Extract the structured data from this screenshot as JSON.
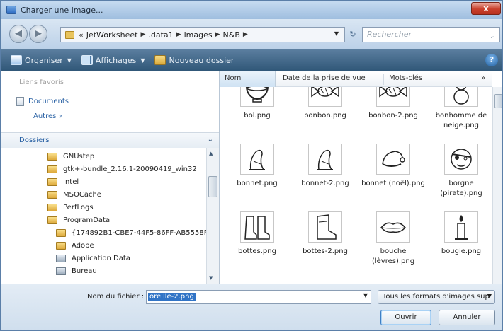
{
  "window": {
    "title": "Charger une image...",
    "close_label": "x"
  },
  "nav": {
    "back_glyph": "◀",
    "forward_glyph": "▶"
  },
  "breadcrumb": {
    "prefix": "«",
    "items": [
      "JetWorksheet",
      ".data1",
      "images",
      "N&B"
    ],
    "separator": "▶",
    "dropdown_glyph": "▼"
  },
  "refresh_glyph": "↻",
  "search": {
    "placeholder": "Rechercher",
    "icon_glyph": "⌕"
  },
  "toolbar": {
    "organize_label": "Organiser",
    "views_label": "Affichages",
    "new_folder_label": "Nouveau dossier",
    "caret": "▼",
    "help_glyph": "?"
  },
  "favorites": {
    "title": "Liens favoris",
    "documents_label": "Documents",
    "more_label": "Autres »"
  },
  "folders": {
    "title": "Dossiers",
    "chevron": "⌄",
    "tree": [
      {
        "label": "GNUstep",
        "kind": "folder",
        "indent": 1
      },
      {
        "label": "gtk+-bundle_2.16.1-20090419_win32",
        "kind": "folder",
        "indent": 1
      },
      {
        "label": "Intel",
        "kind": "folder",
        "indent": 1
      },
      {
        "label": "MSOCache",
        "kind": "folder",
        "indent": 1
      },
      {
        "label": "PerfLogs",
        "kind": "folder",
        "indent": 1
      },
      {
        "label": "ProgramData",
        "kind": "folder",
        "indent": 1
      },
      {
        "label": "{174892B1-CBE7-44F5-86FF-AB5558F",
        "kind": "folder",
        "indent": 2
      },
      {
        "label": "Adobe",
        "kind": "folder",
        "indent": 2
      },
      {
        "label": "Application Data",
        "kind": "sysfolder",
        "indent": 2
      },
      {
        "label": "Bureau",
        "kind": "sysfolder",
        "indent": 2
      }
    ]
  },
  "columns": {
    "name": "Nom",
    "date": "Date de la prise de vue",
    "tags": "Mots-clés",
    "more": "»"
  },
  "files": [
    {
      "name": "bol.png",
      "icon": "bowl"
    },
    {
      "name": "bonbon.png",
      "icon": "candy"
    },
    {
      "name": "bonbon-2.png",
      "icon": "candy"
    },
    {
      "name": "bonhomme de neige.png",
      "icon": "snowman"
    },
    {
      "name": "bonnet.png",
      "icon": "hat"
    },
    {
      "name": "bonnet-2.png",
      "icon": "hat"
    },
    {
      "name": "bonnet (noël).png",
      "icon": "santa-hat"
    },
    {
      "name": "borgne (pirate).png",
      "icon": "pirate-face"
    },
    {
      "name": "bottes.png",
      "icon": "boots"
    },
    {
      "name": "bottes-2.png",
      "icon": "boot"
    },
    {
      "name": "bouche (lèvres).png",
      "icon": "lips"
    },
    {
      "name": "bougie.png",
      "icon": "candle"
    }
  ],
  "bottom": {
    "filename_label": "Nom du fichier :",
    "filename_value": "oreille-2.png",
    "filename_dropdown": "▼",
    "filetype_value": "Tous les formats d'images sup",
    "filetype_dropdown": "▼",
    "open_label": "Ouvrir",
    "cancel_label": "Annuler"
  }
}
